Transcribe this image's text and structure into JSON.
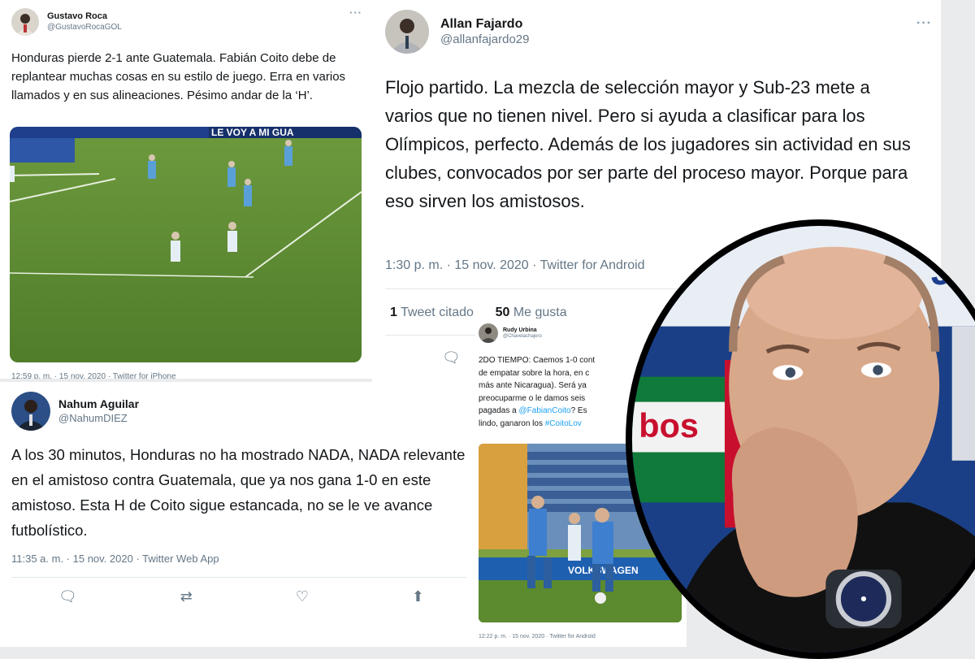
{
  "tweets": {
    "gustavo": {
      "display_name": "Gustavo Roca",
      "handle": "@GustavoRocaGOL",
      "text": "Honduras pierde 2-1 ante Guatemala. Fabián Coito debe de replantear muchas cosas en su estilo de juego. Erra en varios llamados y en sus alineaciones. Pésimo andar de la ‘H’.",
      "banner_text": "LE VOY A MI GUA",
      "timestamp": "12:59 p. m. · 15 nov. 2020 · Twitter for iPhone"
    },
    "allan": {
      "display_name": "Allan Fajardo",
      "handle": "@allanfajardo29",
      "text": "Flojo partido. La mezcla de selección mayor y Sub-23 mete a varios que no tienen nivel. Pero si ayuda a clasificar para los Olímpicos, perfecto. Además de los jugadores sin actividad en sus clubes, convocados por ser parte del proceso mayor. Porque para eso sirven los amistosos.",
      "timestamp": "1:30 p. m. · 15 nov. 2020 · Twitter for Android",
      "quote_count": "1",
      "quote_label": "Tweet citado",
      "like_count": "50",
      "like_label": "Me gusta"
    },
    "nahum": {
      "display_name": "Nahum Aguilar",
      "handle": "@NahumDIEZ",
      "text": "A los 30 minutos, Honduras no ha mostrado NADA, NADA relevante en el amistoso contra Guatemala, que ya nos gana 1-0 en este amistoso. Esta H de Coito sigue estancada, no se le ve avance futbolístico.",
      "timestamp": "11:35 a. m. · 15 nov. 2020 · Twitter Web App"
    },
    "rudy": {
      "display_name": "Rudy Urbina",
      "handle": "@Chavelachajero",
      "line1": "2DO TIEMPO: Caemos 1-0 cont",
      "line2": "de empatar  sobre la hora, en c",
      "line3": "más ante Nicaragua). Será ya",
      "line4": "preocuparme o le damos seis",
      "line5_pre": "pagadas a ",
      "line5_link": "@FabianCoito",
      "line5_post": "? Es",
      "line6_pre": "lindo, ganaron los ",
      "line6_link": "#CoitoLov",
      "sign_text": "VOLKSWAGEN",
      "timestamp": "12:22 p. m. · 15 nov. 2020 · Twitter for Android"
    }
  },
  "photo_text": {
    "sponsor_top": "Je",
    "sponsor_side": "bos"
  },
  "icons": [
    "more-icon",
    "reply-icon",
    "retweet-icon",
    "like-icon",
    "share-icon"
  ]
}
